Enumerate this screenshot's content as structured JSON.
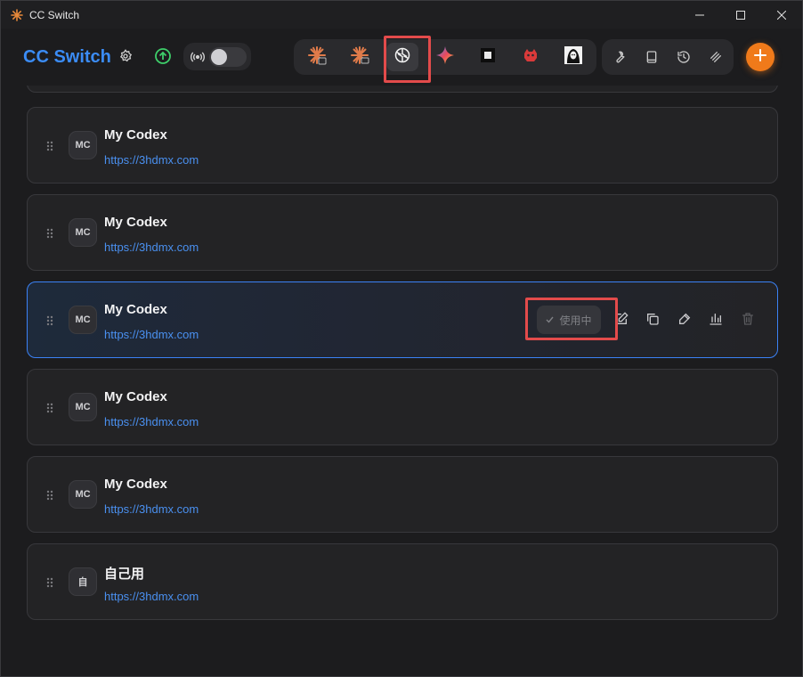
{
  "window": {
    "title": "CC Switch"
  },
  "header": {
    "brand": "CC Switch",
    "proxy_enabled": false,
    "app_tabs": [
      {
        "name": "claude-code",
        "icon": "claude-cli-icon",
        "active": false
      },
      {
        "name": "claude-desktop",
        "icon": "claude-desktop-icon",
        "active": false
      },
      {
        "name": "codex",
        "icon": "openai-icon",
        "active": true
      },
      {
        "name": "gemini",
        "icon": "gemini-icon",
        "active": false
      },
      {
        "name": "opencode",
        "icon": "square-icon",
        "active": false
      },
      {
        "name": "other-agent",
        "icon": "red-robot-icon",
        "active": false
      },
      {
        "name": "another-agent",
        "icon": "portrait-icon",
        "active": false
      }
    ],
    "tools": [
      "wrench-icon",
      "book-icon",
      "history-icon",
      "layers-icon"
    ]
  },
  "providers": [
    {
      "avatar": "MC",
      "name": "My Codex",
      "url": "https://3hdmx.com",
      "active": false
    },
    {
      "avatar": "MC",
      "name": "My Codex",
      "url": "https://3hdmx.com",
      "active": false
    },
    {
      "avatar": "MC",
      "name": "My Codex",
      "url": "https://3hdmx.com",
      "active": true
    },
    {
      "avatar": "MC",
      "name": "My Codex",
      "url": "https://3hdmx.com",
      "active": false
    },
    {
      "avatar": "MC",
      "name": "My Codex",
      "url": "https://3hdmx.com",
      "active": false
    },
    {
      "avatar": "自",
      "name": "自己用",
      "url": "https://3hdmx.com",
      "active": false
    }
  ],
  "active_card": {
    "in_use_label": "使用中"
  },
  "colors": {
    "accent": "#3b8cf5",
    "add_button": "#f07a1a",
    "highlight": "#e34b4b",
    "link": "#4a90f0"
  }
}
